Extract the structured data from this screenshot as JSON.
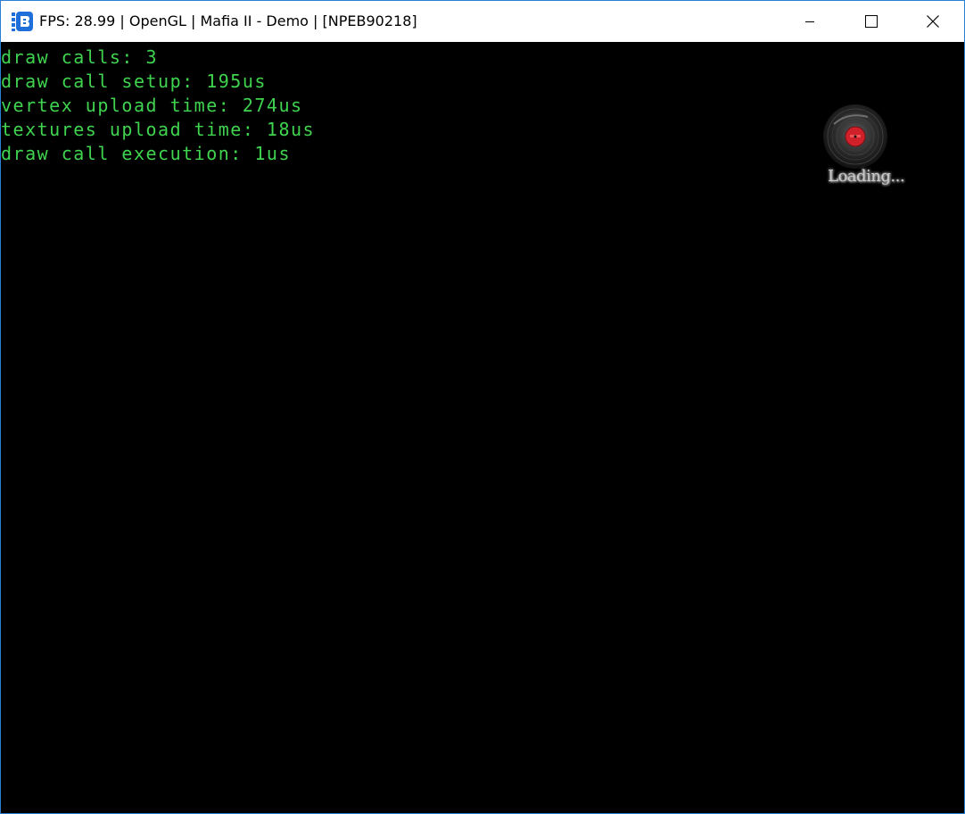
{
  "window": {
    "title": "FPS: 28.99 | OpenGL | Mafia II - Demo | [NPEB90218]",
    "app_icon": "rpcs3-app-icon",
    "controls": {
      "minimize_icon": "minimize-icon",
      "maximize_icon": "maximize-icon",
      "close_icon": "close-icon"
    }
  },
  "overlay": {
    "color": "#3fd34f",
    "lines": [
      "draw calls: 3",
      "draw call setup: 195us",
      "vertex upload time: 274us",
      "textures upload time: 18us",
      "draw call execution: 1us"
    ]
  },
  "loader": {
    "icon": "vinyl-record-icon",
    "text": "Loading..."
  }
}
